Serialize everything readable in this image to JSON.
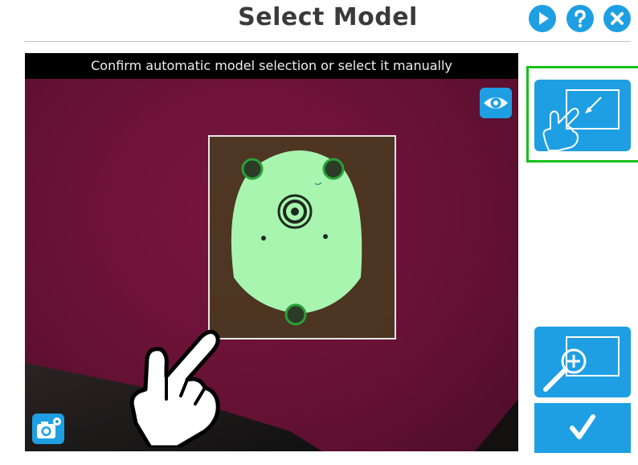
{
  "header": {
    "title": "Select Model",
    "icons": [
      "play-icon",
      "help-icon",
      "close-icon"
    ]
  },
  "camera_view": {
    "instruction": "Confirm automatic model selection or select it manually",
    "icons": [
      "eye-icon",
      "camera-settings-icon",
      "hand-pointer-icon"
    ]
  },
  "side_buttons": {
    "select_area": {
      "icon": "select-area-icon",
      "selected": true
    },
    "zoom": {
      "icon": "zoom-in-icon"
    },
    "confirm": {
      "icon": "checkmark-icon"
    }
  },
  "colors": {
    "accent": "#1e9fe3",
    "selected_outline": "#18c01c",
    "title": "#3a3a3a",
    "camera_header_bg": "#000000",
    "model_highlight": "#a8f5b0"
  }
}
